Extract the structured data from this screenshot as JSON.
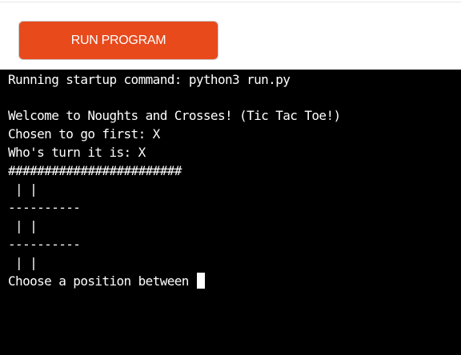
{
  "toolbar": {
    "run_label": "RUN PROGRAM"
  },
  "terminal": {
    "lines": [
      "Running startup command: python3 run.py",
      "",
      "Welcome to Noughts and Crosses! (Tic Tac Toe!)",
      "Chosen to go first: X",
      "Who's turn it is: X",
      "########################",
      " | |",
      "----------",
      " | |",
      "----------",
      " | |",
      "Choose a position between "
    ]
  }
}
